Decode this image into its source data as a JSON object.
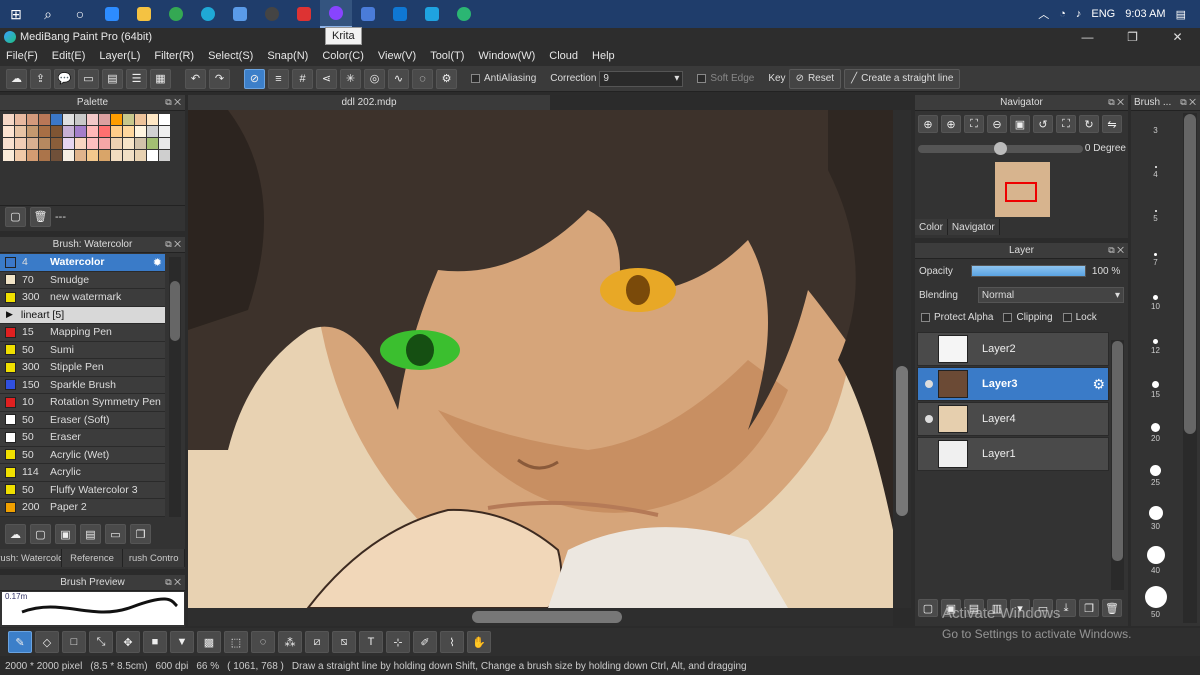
{
  "taskbar": {
    "icons": [
      "windows-icon",
      "search-icon",
      "cortana-icon",
      "zoom-icon",
      "file-explorer-icon",
      "chrome-icon",
      "edge-icon",
      "store-icon",
      "obs-icon",
      "pdf-icon",
      "krita-icon",
      "zoom2-icon",
      "mail-icon",
      "telegram-icon",
      "chrome2-icon"
    ],
    "tray": {
      "lang": "ENG",
      "time": "9:03 AM"
    }
  },
  "tooltip": "Krita",
  "window": {
    "title": "MediBang Paint Pro (64bit)"
  },
  "menu": [
    "File(F)",
    "Edit(E)",
    "Layer(L)",
    "Filter(R)",
    "Select(S)",
    "Snap(N)",
    "Color(C)",
    "View(V)",
    "Tool(T)",
    "Window(W)",
    "Cloud",
    "Help"
  ],
  "toolbar": {
    "antialiasing": "AntiAliasing",
    "correction_label": "Correction",
    "correction_value": "9",
    "soft_edge": "Soft Edge",
    "key_label": "Key",
    "reset_label": "Reset",
    "straight_line_label": "Create a straight line"
  },
  "palette": {
    "title": "Palette",
    "footer_text": "---",
    "colors": [
      "#f5d7c6",
      "#e8b9a0",
      "#d49a7c",
      "#b97757",
      "#3b78c9",
      "#e0e0e0",
      "#c8c8c8",
      "#f2c7c7",
      "#dba0a0",
      "#ff9d00",
      "#c8c88c",
      "#eec39a",
      "#ffe7c4",
      "#ffffff",
      "#fce3d1",
      "#e7c4a5",
      "#c4996f",
      "#a86f45",
      "#7f5533",
      "#c7b0d5",
      "#a47ecb",
      "#ffb8b8",
      "#ff7070",
      "#ffcd8a",
      "#ffd89e",
      "#fff5e0",
      "#d1d1d1",
      "#f0f0f0",
      "#f8e0cf",
      "#f1cdb5",
      "#d8b091",
      "#b68960",
      "#8a5e3a",
      "#e6d5f1",
      "#f9d6c1",
      "#ffbfbf",
      "#f5a7a7",
      "#eed2b2",
      "#f6e4c8",
      "#d1c2aa",
      "#a3bf73",
      "#e8e8e8",
      "#faebd9",
      "#f0c9a8",
      "#d49c72",
      "#ab744a",
      "#705039",
      "#f7efe4",
      "#e0b48c",
      "#f3c88d",
      "#d9a569",
      "#f2dcc0",
      "#f1dfc5",
      "#e7d1b1",
      "#ffffff",
      "#cfcfcf"
    ]
  },
  "brush": {
    "title": "Brush: Watercolor",
    "items": [
      {
        "size": "4",
        "name": "Watercolor",
        "color": "#3b78c9",
        "selected": true
      },
      {
        "size": "70",
        "name": "Smudge",
        "color": "#f2e5c8"
      },
      {
        "size": "300",
        "name": "new watermark",
        "color": "#f0e000"
      },
      {
        "size": "",
        "name": "lineart [5]",
        "color": "",
        "group": true
      },
      {
        "size": "15",
        "name": "Mapping Pen",
        "color": "#e02020"
      },
      {
        "size": "50",
        "name": "Sumi",
        "color": "#f0e000"
      },
      {
        "size": "300",
        "name": "Stipple Pen",
        "color": "#f0e000"
      },
      {
        "size": "150",
        "name": "Sparkle Brush",
        "color": "#3050e0"
      },
      {
        "size": "10",
        "name": "Rotation Symmetry Pen",
        "color": "#e02020"
      },
      {
        "size": "50",
        "name": "Eraser (Soft)",
        "color": "#ffffff"
      },
      {
        "size": "50",
        "name": "Eraser",
        "color": "#ffffff"
      },
      {
        "size": "50",
        "name": "Acrylic (Wet)",
        "color": "#f0e000"
      },
      {
        "size": "114",
        "name": "Acrylic",
        "color": "#f0e000"
      },
      {
        "size": "50",
        "name": "Fluffy Watercolor 3",
        "color": "#f0e000"
      },
      {
        "size": "200",
        "name": "Paper 2",
        "color": "#f0a000"
      }
    ],
    "tabs": [
      "rush: Watercolo",
      "Reference",
      "rush Contro"
    ],
    "preview_title": "Brush Preview",
    "preview_size": "0.17m"
  },
  "canvas": {
    "tab": "ddl 202.mdp"
  },
  "navigator": {
    "title": "Navigator",
    "degree": "0 Degree",
    "tabs": [
      "Color",
      "Navigator"
    ]
  },
  "layer": {
    "title": "Layer",
    "opacity_label": "Opacity",
    "opacity_value": "100 %",
    "opacity_fraction": 1.0,
    "blending_label": "Blending",
    "blending_value": "Normal",
    "protect_alpha": "Protect Alpha",
    "clipping": "Clipping",
    "lock": "Lock",
    "layers": [
      {
        "name": "Layer2",
        "visible": false,
        "selected": false,
        "thumb": "#f5f5f5"
      },
      {
        "name": "Layer3",
        "visible": true,
        "selected": true,
        "thumb": "#6b4a35"
      },
      {
        "name": "Layer4",
        "visible": true,
        "selected": false,
        "thumb": "#e6cfae"
      },
      {
        "name": "Layer1",
        "visible": false,
        "selected": false,
        "thumb": "#f0f0f0"
      }
    ]
  },
  "brush_size": {
    "title": "Brush ...",
    "sizes": [
      "3",
      "4",
      "5",
      "7",
      "10",
      "12",
      "15",
      "20",
      "25",
      "30",
      "40",
      "50"
    ]
  },
  "activate": {
    "line1": "Activate Windows",
    "line2": "Go to Settings to activate Windows."
  },
  "status": {
    "size": "2000 * 2000 pixel",
    "physical": "(8.5 * 8.5cm)",
    "dpi": "600 dpi",
    "zoom": "66 %",
    "coords": "( 1061, 768 )",
    "hint": "Draw a straight line by holding down Shift, Change a brush size by holding down Ctrl, Alt, and dragging"
  }
}
